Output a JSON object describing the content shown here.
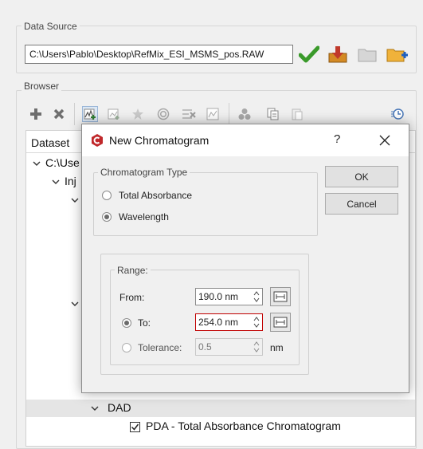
{
  "data_source": {
    "group_title": "Data Source",
    "path": "C:\\Users\\Pablo\\Desktop\\RefMix_ESI_MSMS_pos.RAW"
  },
  "browser": {
    "group_title": "Browser",
    "tree": {
      "header": "Dataset",
      "root_label": "C:\\Use",
      "child_label": "Inj",
      "dad_label": "DAD",
      "chromatogram_item": "PDA - Total Absorbance Chromatogram",
      "chromatogram_checked": true
    }
  },
  "dialog": {
    "title": "New Chromatogram",
    "help": "?",
    "ok_label": "OK",
    "cancel_label": "Cancel",
    "type_group": {
      "title": "Chromatogram Type",
      "options": [
        {
          "label": "Total Absorbance",
          "selected": false
        },
        {
          "label": "Wavelength",
          "selected": true
        }
      ]
    },
    "range_group": {
      "title": "Range:",
      "from_label": "From:",
      "from_value": "190.0 nm",
      "to_label": "To:",
      "to_value": "254.0 nm",
      "to_selected": true,
      "tolerance_label": "Tolerance:",
      "tolerance_value": "0.5",
      "tolerance_unit": "nm",
      "tolerance_selected": false
    }
  },
  "colors": {
    "accent_green": "#3a9a2a",
    "accent_orange": "#e08a1a",
    "focus_red": "#c00000"
  }
}
